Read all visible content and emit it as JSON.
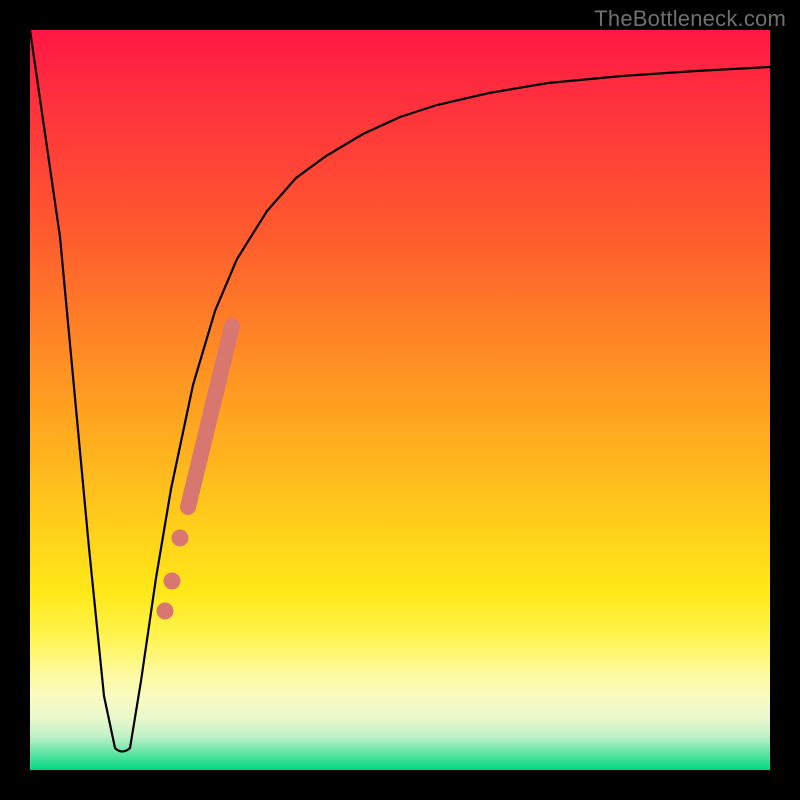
{
  "watermark": "TheBottleneck.com",
  "chart_data": {
    "type": "line",
    "title": "",
    "xlabel": "",
    "ylabel": "",
    "xlim": [
      0,
      100
    ],
    "ylim": [
      0,
      100
    ],
    "series": [
      {
        "name": "bottleneck-curve",
        "x": [
          0,
          4,
          8,
          10,
          11.5,
          12.5,
          13.5,
          15,
          17,
          19,
          22,
          25,
          28,
          32,
          36,
          40,
          45,
          50,
          55,
          62,
          70,
          80,
          90,
          100
        ],
        "y": [
          100,
          72,
          30,
          10,
          3,
          2,
          3,
          12,
          26,
          38,
          52,
          62,
          69,
          75.5,
          80,
          83,
          86,
          88.2,
          89.8,
          91.5,
          92.8,
          93.8,
          94.5,
          95
        ]
      },
      {
        "name": "highlighted-segment",
        "x": [
          17.5,
          20,
          23,
          26,
          28
        ],
        "y": [
          29,
          44,
          55,
          58,
          60
        ]
      },
      {
        "name": "highlighted-dots",
        "x": [
          21.5,
          20.2,
          19.2,
          18.3
        ],
        "y": [
          35.5,
          30,
          25.5,
          21.5
        ]
      }
    ],
    "background_gradient": {
      "top": "#ff1744",
      "middle": "#ffd21a",
      "bottom": "#00d880"
    }
  }
}
